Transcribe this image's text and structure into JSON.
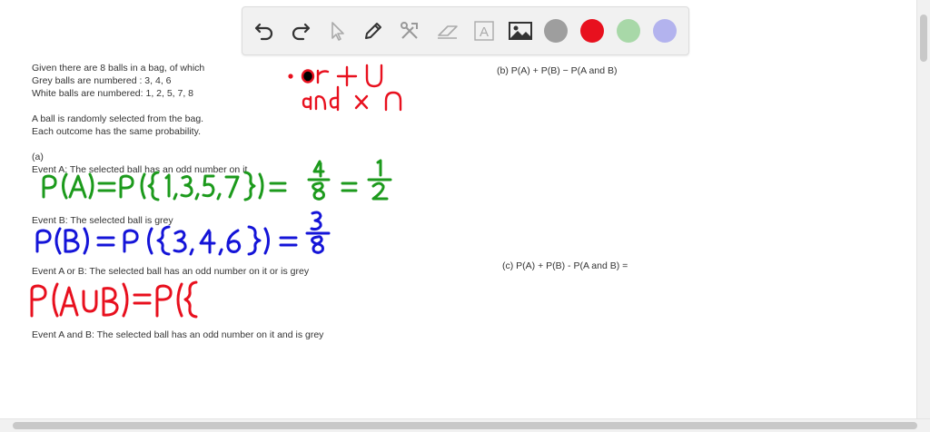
{
  "toolbar": {
    "tools": [
      {
        "name": "undo-icon"
      },
      {
        "name": "redo-icon"
      },
      {
        "name": "pointer-icon"
      },
      {
        "name": "pen-icon"
      },
      {
        "name": "tools-icon"
      },
      {
        "name": "eraser-icon"
      },
      {
        "name": "text-icon",
        "glyph": "A"
      },
      {
        "name": "image-icon"
      }
    ],
    "colors": [
      "#9e9e9e",
      "#e8101e",
      "#a8d8a8",
      "#b3b3ee"
    ]
  },
  "problem": {
    "intro_1": "Given there are 8 balls in a bag, of which",
    "intro_2": "Grey balls are numbered : 3, 4, 6",
    "intro_3": "White balls are numbered: 1, 2, 5, 7, 8",
    "intro_4": "A ball is randomly selected from the bag.",
    "intro_5": "Each outcome has the same probability.",
    "part_a_label": "(a)",
    "event_a": "Event A: The selected ball has an odd number on it",
    "event_b": "Event B: The selected ball is grey",
    "event_a_or_b": "Event A or B: The selected ball has an odd number on it or is grey",
    "event_a_and_b": "Event A and B: The selected ball has an odd number on it and is grey",
    "part_b": "(b) P(A) + P(B) − P(A and B)",
    "part_c": "(c) P(A) + P(B) - P(A and B) ="
  },
  "handwriting": {
    "note_line_1": "· or + ∪",
    "note_line_2": "and × ∩",
    "pa": "P(A)=P({1,3,5,7})= 4/8 = 1/2",
    "pb": "P(B)=P({3,4,6})= 3/8",
    "paub": "P(A∪B)=P({",
    "colors": {
      "red": "#e8101e",
      "green": "#1c9a1c",
      "blue": "#1414d8"
    }
  }
}
